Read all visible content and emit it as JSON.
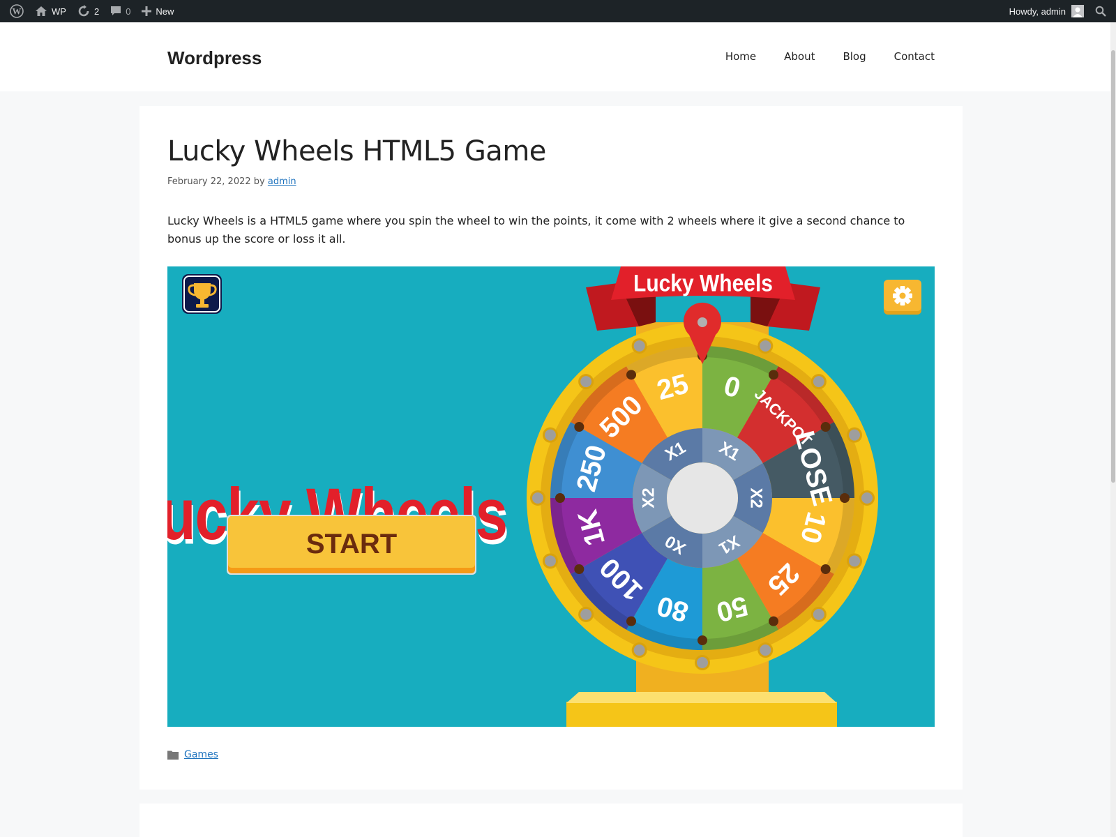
{
  "admin_bar": {
    "site_label": "WP",
    "updates_count": "2",
    "comments_count": "0",
    "new_label": "New",
    "greeting": "Howdy, admin"
  },
  "header": {
    "site_title": "Wordpress",
    "nav": [
      "Home",
      "About",
      "Blog",
      "Contact"
    ]
  },
  "post": {
    "title": "Lucky Wheels HTML5 Game",
    "date": "February 22, 2022",
    "by": "by",
    "author": "admin",
    "body": "Lucky Wheels is a HTML5 game where you spin the wheel to win the points, it come with 2 wheels where it give a second chance to bonus up the score or loss it all.",
    "category": "Games"
  },
  "game": {
    "banner_text": "Lucky Wheels",
    "logo_text": "Lucky Wheels",
    "start_label": "START",
    "outer_segments": [
      {
        "label": "0",
        "color": "#7cb342"
      },
      {
        "label": "JACKPOT",
        "color": "#d32f2f"
      },
      {
        "label": "LOSE",
        "color": "#455a64"
      },
      {
        "label": "10",
        "color": "#fbc02d"
      },
      {
        "label": "25",
        "color": "#f57c22"
      },
      {
        "label": "50",
        "color": "#7cb342"
      },
      {
        "label": "80",
        "color": "#1e9ad6"
      },
      {
        "label": "100",
        "color": "#3f51b5"
      },
      {
        "label": "1K",
        "color": "#8e2aa0"
      },
      {
        "label": "250",
        "color": "#3f8fd2"
      },
      {
        "label": "500",
        "color": "#f57c22"
      },
      {
        "label": "25",
        "color": "#fbc02d"
      }
    ],
    "inner_segments": [
      "X1",
      "X2",
      "X1",
      "X0",
      "X2",
      "X1"
    ],
    "colors": {
      "background": "#17adbf",
      "title_red": "#e2202a",
      "button_yellow": "#f8c43a",
      "wheel_rim": "#f5c518",
      "pointer": "#e02b2b",
      "settings_button": "#f7b731",
      "trophy_button": "#0d1a4a"
    },
    "icons": [
      "trophy-icon",
      "settings-gear-icon",
      "pointer-icon"
    ]
  }
}
